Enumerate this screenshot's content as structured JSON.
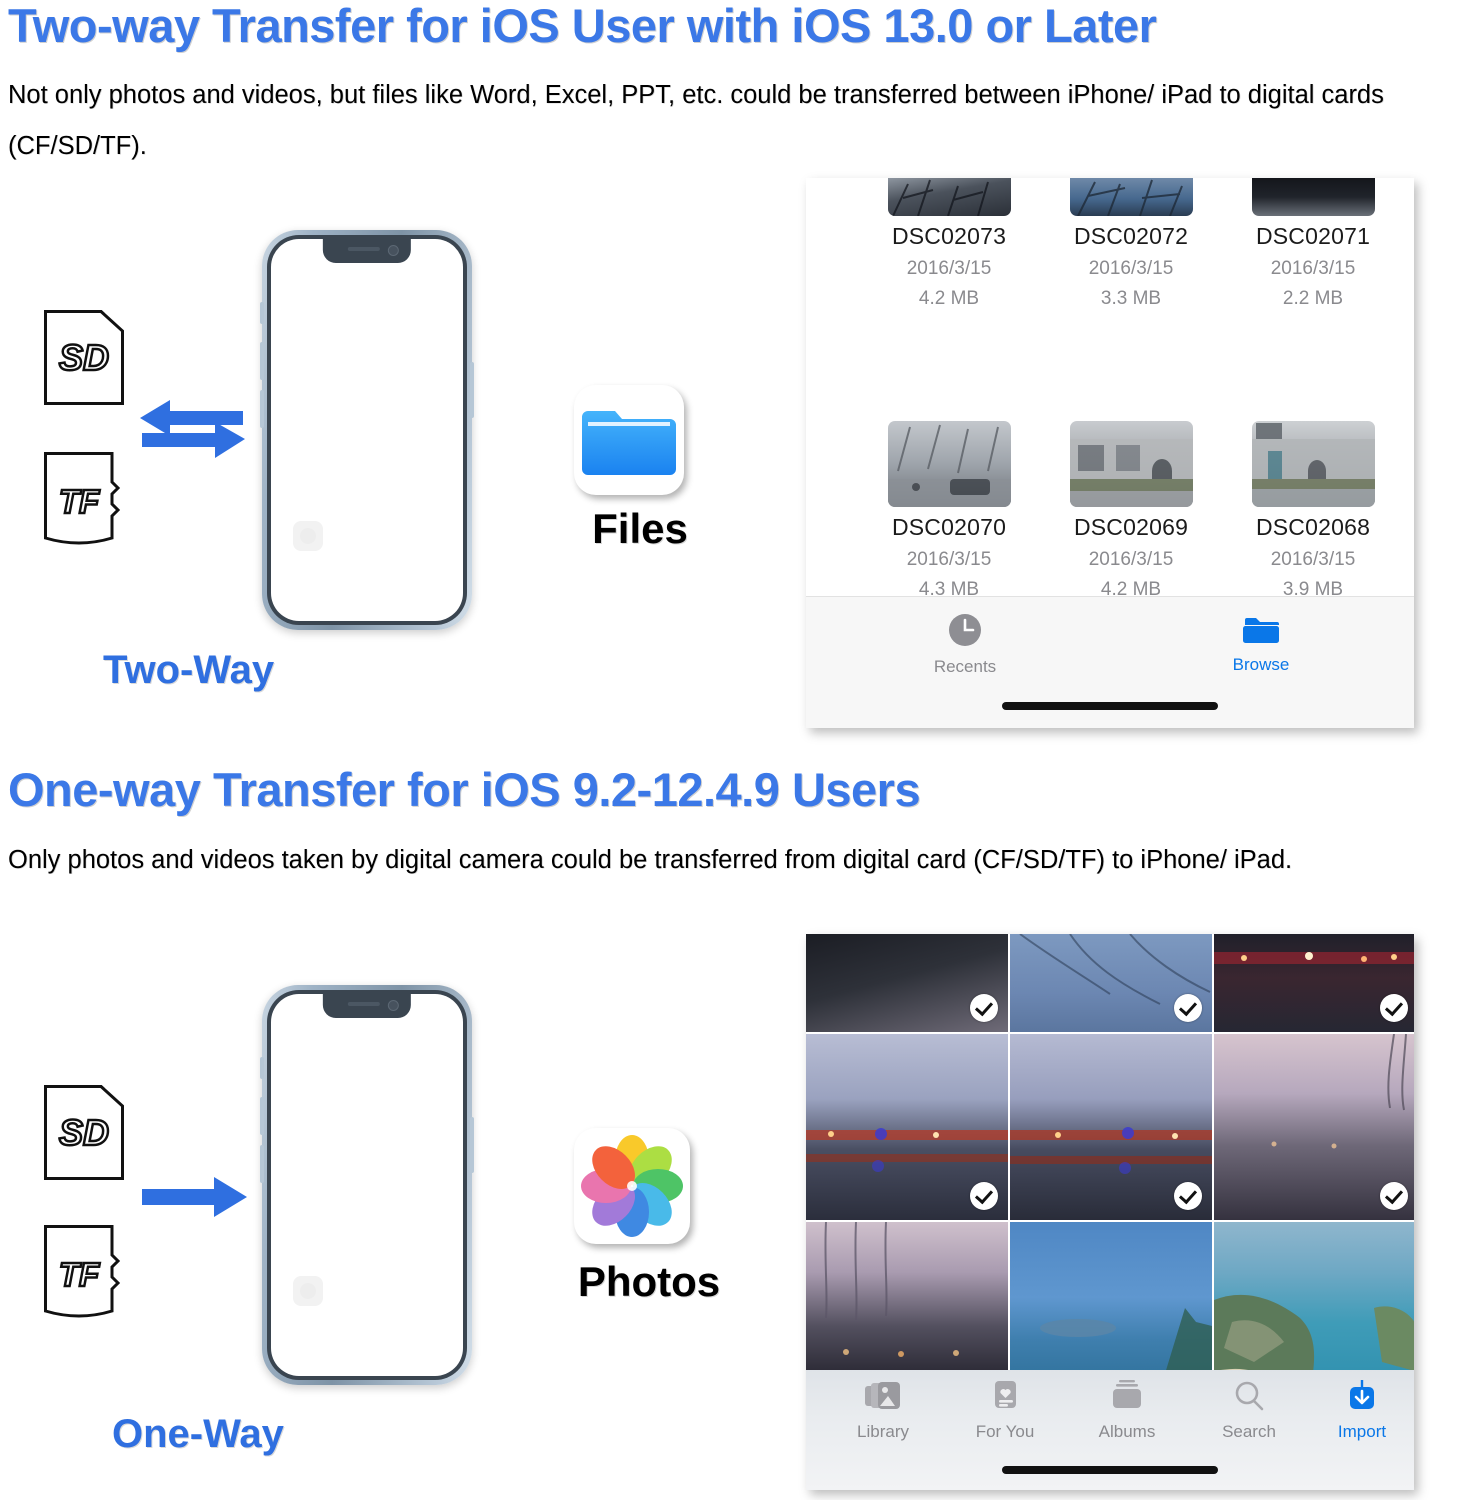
{
  "sections": [
    {
      "id": "two-way",
      "heading": "Two-way Transfer for iOS User with iOS 13.0 or Later",
      "description": "Not only photos and videos, but files like Word, Excel, PPT, etc. could be transferred between iPhone/ iPad to digital cards (CF/SD/TF).",
      "way_label": "Two-Way",
      "arrow_type": "double-arrow",
      "cards": [
        "SD",
        "TF"
      ],
      "app": {
        "name": "Files",
        "icon": "files-folder-icon"
      }
    },
    {
      "id": "one-way",
      "heading": "One-way Transfer for iOS 9.2-12.4.9 Users",
      "description": "Only photos and videos taken by digital camera could be transferred from digital card (CF/SD/TF) to iPhone/ iPad.",
      "way_label": "One-Way",
      "arrow_type": "single-arrow",
      "cards": [
        "SD",
        "TF"
      ],
      "app": {
        "name": "Photos",
        "icon": "photos-pinwheel-icon"
      }
    }
  ],
  "files_app": {
    "files": [
      {
        "name": "DSC02073",
        "date": "2016/3/15",
        "size": "4.2 MB",
        "thumb": "bare-trees-dark"
      },
      {
        "name": "DSC02072",
        "date": "2016/3/15",
        "size": "3.3 MB",
        "thumb": "branches-blue-sky"
      },
      {
        "name": "DSC02071",
        "date": "2016/3/15",
        "size": "2.2 MB",
        "thumb": "dark-water"
      },
      {
        "name": "DSC02070",
        "date": "2016/3/15",
        "size": "4.3 MB",
        "thumb": "street-with-cars"
      },
      {
        "name": "DSC02069",
        "date": "2016/3/15",
        "size": "4.2 MB",
        "thumb": "stone-wall-corridor"
      },
      {
        "name": "DSC02068",
        "date": "2016/3/15",
        "size": "3.9 MB",
        "thumb": "wall-and-trees"
      }
    ],
    "tabs": [
      {
        "label": "Recents",
        "icon": "clock-icon",
        "active": false
      },
      {
        "label": "Browse",
        "icon": "folder-icon",
        "active": true
      }
    ]
  },
  "photos_app": {
    "photos": [
      {
        "id": "p1",
        "scene": "dusk-lake-dark-trees",
        "selected": true
      },
      {
        "id": "p2",
        "scene": "blue-branches",
        "selected": true
      },
      {
        "id": "p3",
        "scene": "night-lights-reflection",
        "selected": true
      },
      {
        "id": "p4",
        "scene": "dusk-lake-lights-left",
        "selected": true
      },
      {
        "id": "p5",
        "scene": "dusk-lake-lights-center",
        "selected": true
      },
      {
        "id": "p6",
        "scene": "dusk-lake-pink-sky",
        "selected": true
      },
      {
        "id": "p7",
        "scene": "willow-lake-night",
        "selected": false
      },
      {
        "id": "p8",
        "scene": "blue-sea-island",
        "selected": false
      },
      {
        "id": "p9",
        "scene": "coastal-aerial",
        "selected": false
      }
    ],
    "tabs": [
      {
        "label": "Library",
        "icon": "photos-stack-icon",
        "active": false
      },
      {
        "label": "For You",
        "icon": "for-you-card-icon",
        "active": false
      },
      {
        "label": "Albums",
        "icon": "albums-stack-icon",
        "active": false
      },
      {
        "label": "Search",
        "icon": "search-icon",
        "active": false
      },
      {
        "label": "Import",
        "icon": "import-download-icon",
        "active": true
      }
    ]
  },
  "colors": {
    "heading_blue": "#3b78e7",
    "arrow_blue": "#2f6fe0",
    "tab_active_blue": "#0a77e8",
    "tab_inactive_gray": "#8a8a8e"
  }
}
